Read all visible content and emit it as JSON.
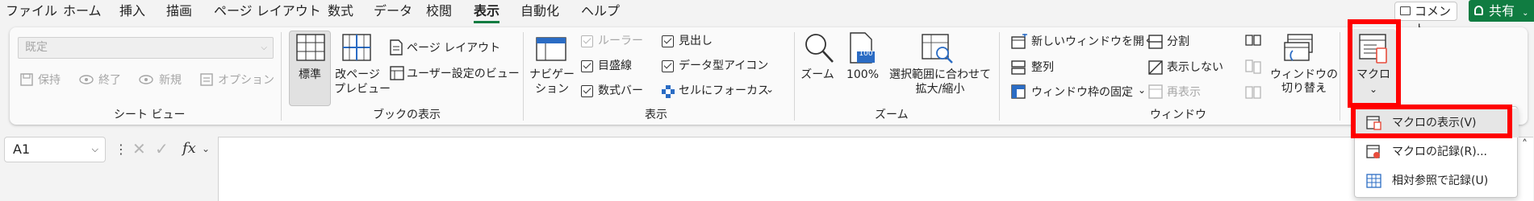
{
  "menu": {
    "tabs": [
      "ファイル",
      "ホーム",
      "挿入",
      "描画",
      "ページ レイアウト",
      "数式",
      "データ",
      "校閲",
      "表示",
      "自動化",
      "ヘルプ"
    ],
    "active_tab": "表示",
    "comment_label": "コメント",
    "share_label": "共有"
  },
  "sheet_view": {
    "select_value": "既定",
    "keep_label": "保持",
    "exit_label": "終了",
    "new_label": "新規",
    "options_label": "オプション",
    "group_label": "シート ビュー"
  },
  "workbook_views": {
    "normal_label": "標準",
    "page_break_label_1": "改ページ",
    "page_break_label_2": "プレビュー",
    "page_layout_label": "ページ レイアウト",
    "custom_views_label": "ユーザー設定のビュー",
    "group_label": "ブックの表示"
  },
  "show": {
    "navigation_label_1": "ナビゲー",
    "navigation_label_2": "ション",
    "ruler_label": "ルーラー",
    "gridlines_label": "目盛線",
    "formula_bar_label": "数式バー",
    "headings_label": "見出し",
    "data_type_icons_label": "データ型アイコン",
    "focus_cell_label": "セルにフォーカス",
    "group_label": "表示"
  },
  "zoom": {
    "zoom_label": "ズーム",
    "zoom100_label": "100%",
    "zoom_badge": "100",
    "zoom_selection_label_1": "選択範囲に合わせて",
    "zoom_selection_label_2": "拡大/縮小",
    "group_label": "ズーム"
  },
  "window": {
    "new_window_label": "新しいウィンドウを開く",
    "arrange_all_label": "整列",
    "freeze_panes_label": "ウィンドウ枠の固定",
    "split_label": "分割",
    "hide_label": "表示しない",
    "unhide_label": "再表示",
    "switch_windows_label_1": "ウィンドウの",
    "switch_windows_label_2": "切り替え",
    "group_label": "ウィンドウ"
  },
  "macros": {
    "macros_label": "マクロ",
    "menu": [
      {
        "label": "マクロの表示(V)"
      },
      {
        "label": "マクロの記録(R)..."
      },
      {
        "label": "相対参照で記録(U)"
      }
    ]
  },
  "formula_bar": {
    "name_box": "A1",
    "fx_label": "fx"
  },
  "colors": {
    "accent": "#107c41",
    "highlight": "#ff0000"
  }
}
